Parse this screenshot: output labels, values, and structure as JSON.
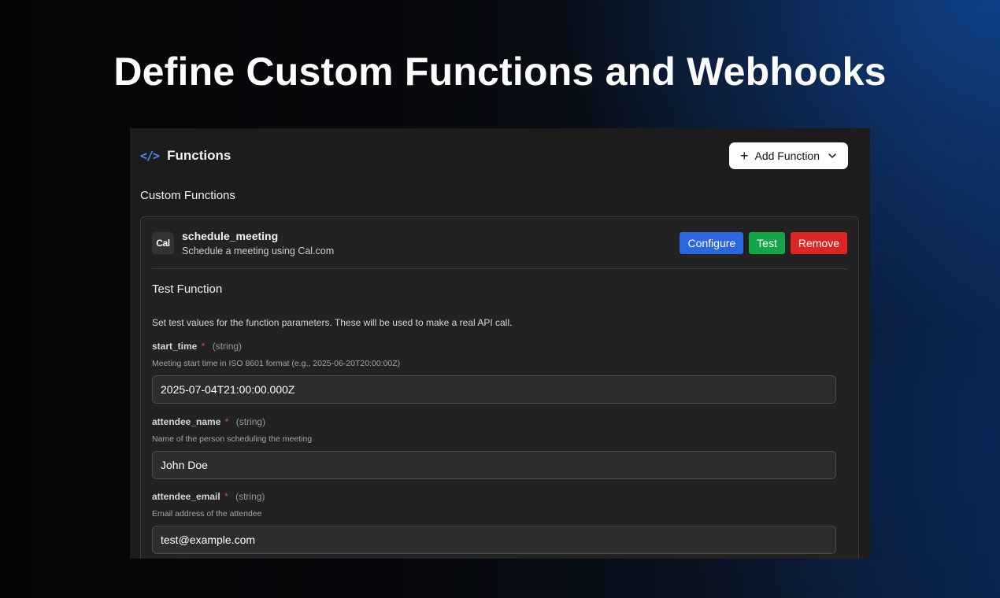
{
  "hero": {
    "title": "Define Custom Functions and Webhooks"
  },
  "panel": {
    "code_icon": "</>",
    "title": "Functions",
    "add_button": {
      "label": "Add Function",
      "plus_icon": "+",
      "chevron_icon": "chevron-down-icon"
    },
    "section_title": "Custom Functions"
  },
  "function": {
    "logo_text": "Cal",
    "name": "schedule_meeting",
    "description": "Schedule a meeting using Cal.com",
    "actions": {
      "configure": "Configure",
      "test": "Test",
      "remove": "Remove"
    },
    "colors": {
      "configure": "#2c67e0",
      "test": "#17a34a",
      "remove": "#dc2626"
    }
  },
  "test": {
    "title": "Test Function",
    "intro": "Set test values for the function parameters. These will be used to make a real API call.",
    "params": [
      {
        "name": "start_time",
        "required": "*",
        "type": "(string)",
        "help": "Meeting start time in ISO 8601 format (e.g., 2025-06-20T20:00:00Z)",
        "value": "2025-07-04T21:00:00.000Z"
      },
      {
        "name": "attendee_name",
        "required": "*",
        "type": "(string)",
        "help": "Name of the person scheduling the meeting",
        "value": "John Doe"
      },
      {
        "name": "attendee_email",
        "required": "*",
        "type": "(string)",
        "help": "Email address of the attendee",
        "value": "test@example.com"
      }
    ]
  }
}
